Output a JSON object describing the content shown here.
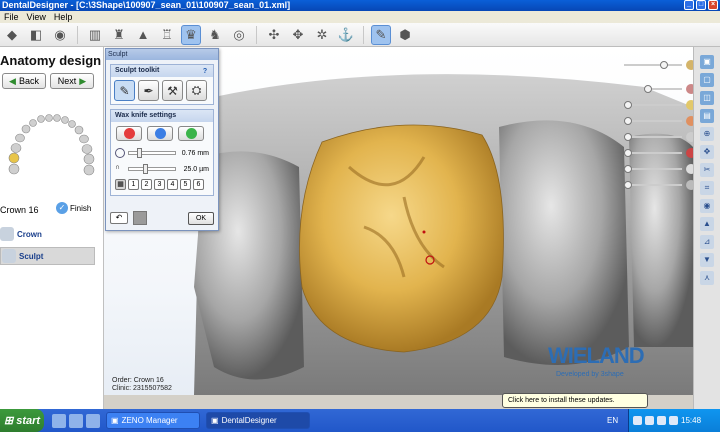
{
  "window": {
    "title": "DentalDesigner - [C:\\3Shape\\100907_sean_01\\100907_sean_01.xml]",
    "controls": [
      "_",
      "□",
      "×"
    ]
  },
  "menu": [
    "File",
    "View",
    "Help"
  ],
  "left_panel": {
    "title": "Anatomy design",
    "back_label": "Back",
    "next_label": "Next",
    "crown_label": "Crown 16",
    "finish_label": "Finish",
    "steps": [
      {
        "label": "Crown"
      },
      {
        "label": "Sculpt"
      }
    ]
  },
  "sculpt_dialog": {
    "title": "Sculpt",
    "toolkit_label": "Sculpt toolkit",
    "help_label": "?",
    "wax_knife_label": "Wax knife settings",
    "radius_value": "0.76 mm",
    "depth_value": "25.0 µm",
    "presets": [
      "1",
      "2",
      "3",
      "4",
      "5",
      "6"
    ],
    "ok_label": "OK"
  },
  "viewport": {
    "order_line": "Order:  Crown 16",
    "clinic_line": "Clinic:  2315507582",
    "brand": "WIELAND",
    "developed_by": "Developed by 3shape"
  },
  "notification": {
    "text": "Click here to install these updates."
  },
  "taskbar": {
    "start_label": "start",
    "tasks": [
      {
        "label": "ZENO Manager"
      },
      {
        "label": "DentalDesigner"
      }
    ],
    "language": "EN",
    "clock": "15:48"
  },
  "colors": {
    "crown": "#e2b44e",
    "model": "#9e9e9e",
    "titlebar": "#0a5fd8",
    "brand": "#2d6db4",
    "taskbar": "#2157c9",
    "start": "#3c9a3c"
  }
}
